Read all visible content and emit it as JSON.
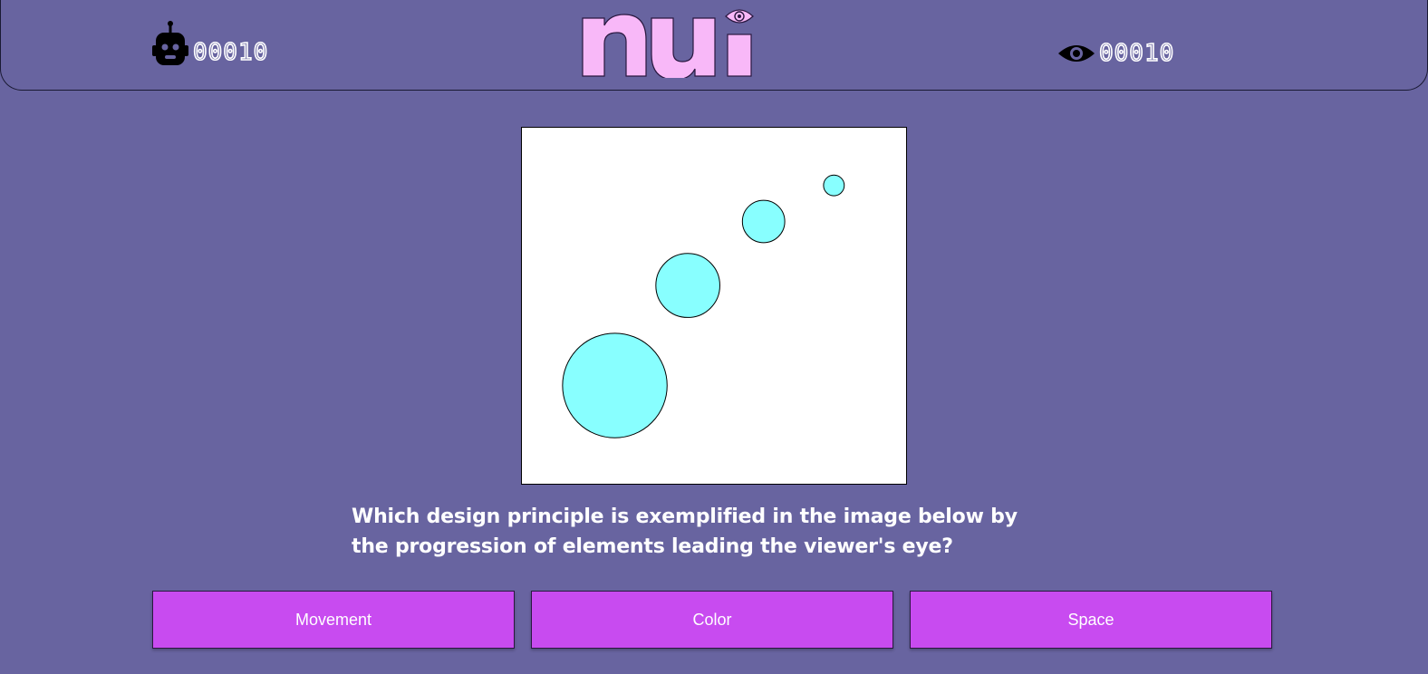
{
  "header": {
    "robot_score": "00010",
    "viewer_score": "00010",
    "logo_text": "nui"
  },
  "question": {
    "text": "Which design principle is exemplified in the image below by the progression of elements leading the viewer's eye?",
    "image": {
      "background": "#ffffff",
      "circle_color": "#88ffff"
    }
  },
  "answers": [
    {
      "label": "Movement"
    },
    {
      "label": "Color"
    },
    {
      "label": "Space"
    }
  ],
  "colors": {
    "background": "#6864a0",
    "accent_pink": "#f8b8f8",
    "button": "#c84bf0",
    "circle": "#88ffff"
  }
}
